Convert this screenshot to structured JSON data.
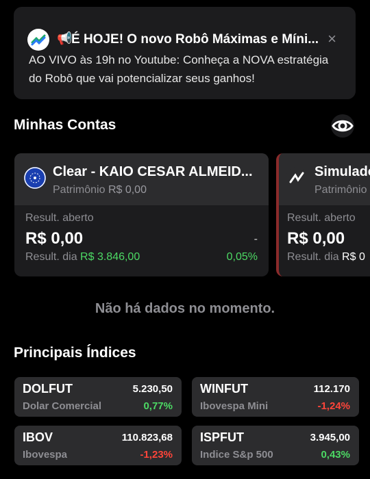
{
  "notification": {
    "title": "É HOJE! O novo Robô Máximas e Míni...",
    "body": "AO VIVO às 19h no Youtube: Conheça a NOVA estratégia do Robô que vai potencializar seus ganhos!",
    "close_icon": "×"
  },
  "accounts_section": {
    "title": "Minhas Contas"
  },
  "accounts": [
    {
      "name": "Clear - KAIO CESAR ALMEID...",
      "patrimonio_label": "Patrimônio",
      "patrimonio_value": "R$ 0,00",
      "open_result_label": "Result. aberto",
      "open_result_value": "R$ 0,00",
      "open_result_change": "-",
      "day_label": "Result. dia",
      "day_value": "R$ 3.846,00",
      "day_pct": "0,05%"
    },
    {
      "name": "Simulado",
      "patrimonio_label": "Patrimônio",
      "open_result_label": "Result. aberto",
      "open_result_value": "R$ 0,00",
      "day_label": "Result. dia",
      "day_value": "R$ 0"
    }
  ],
  "no_data": "Não há dados no momento.",
  "indices_section": {
    "title": "Principais Índices"
  },
  "indices": [
    {
      "code": "DOLFUT",
      "value": "5.230,50",
      "name": "Dolar Comercial",
      "change": "0,77%",
      "direction": "up"
    },
    {
      "code": "WINFUT",
      "value": "112.170",
      "name": "Ibovespa Mini",
      "change": "-1,24%",
      "direction": "down"
    },
    {
      "code": "IBOV",
      "value": "110.823,68",
      "name": "Ibovespa",
      "change": "-1,23%",
      "direction": "down"
    },
    {
      "code": "ISPFUT",
      "value": "3.945,00",
      "name": "Indice S&p 500",
      "change": "0,43%",
      "direction": "up"
    }
  ],
  "colors": {
    "positive": "#4cd964",
    "negative": "#ff453a",
    "card": "#1c1c1e",
    "accent_red": "#8b2b2b"
  },
  "icons": {
    "app": "app-logo-icon",
    "megaphone": "megaphone-icon",
    "eye": "eye-icon",
    "clear": "clear-logo-icon",
    "sim": "simulator-logo-icon"
  }
}
